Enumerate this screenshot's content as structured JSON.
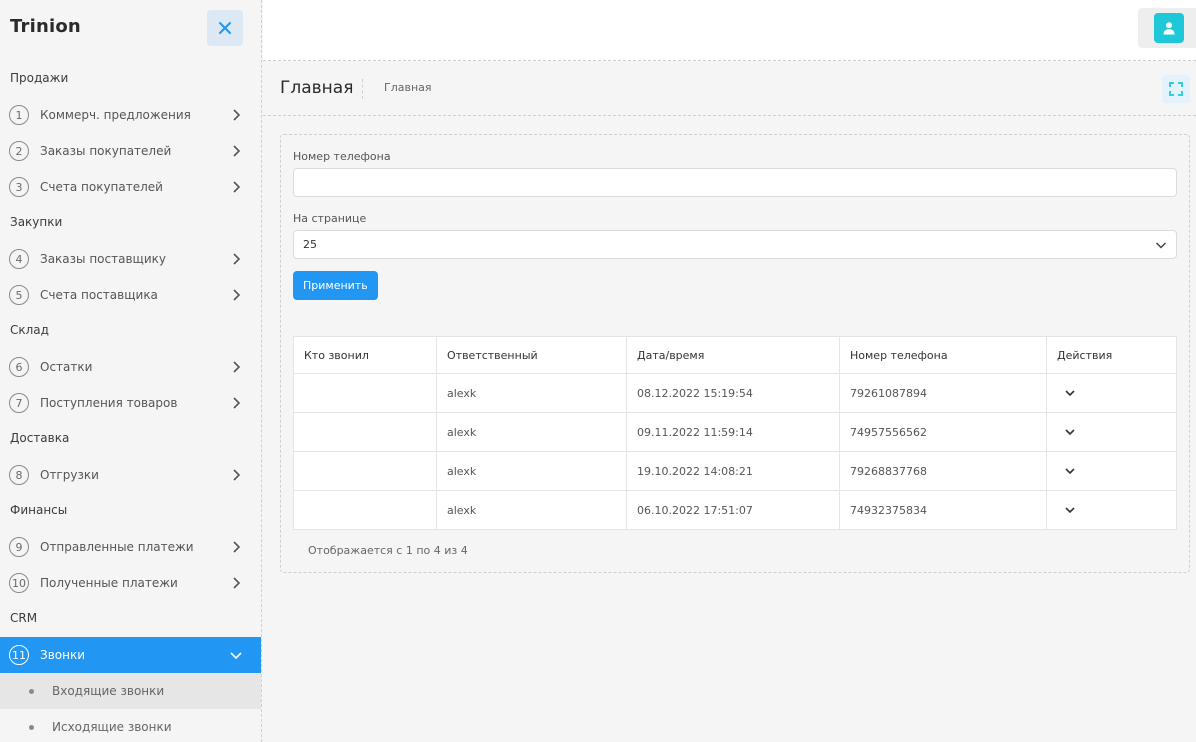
{
  "brand": "Trinion",
  "sidebar": {
    "sections": [
      "Продажи",
      "Закупки",
      "Склад",
      "Доставка",
      "Финансы",
      "CRM"
    ],
    "items": [
      {
        "num": "1",
        "label": "Коммерч. предложения"
      },
      {
        "num": "2",
        "label": "Заказы покупателей"
      },
      {
        "num": "3",
        "label": "Счета покупателей"
      },
      {
        "num": "4",
        "label": "Заказы поставщику"
      },
      {
        "num": "5",
        "label": "Счета поставщика"
      },
      {
        "num": "6",
        "label": "Остатки"
      },
      {
        "num": "7",
        "label": "Поступления товаров"
      },
      {
        "num": "8",
        "label": "Отгрузки"
      },
      {
        "num": "9",
        "label": "Отправленные платежи"
      },
      {
        "num": "10",
        "label": "Полученные платежи"
      },
      {
        "num": "11",
        "label": "Звонки"
      }
    ],
    "subitems": [
      "Входящие звонки",
      "Исходящие звонки"
    ]
  },
  "page": {
    "title": "Главная",
    "breadcrumb": "Главная"
  },
  "filter": {
    "phone_label": "Номер телефона",
    "phone_value": "",
    "per_page_label": "На странице",
    "per_page_value": "25",
    "apply_label": "Применить"
  },
  "table": {
    "headers": [
      "Кто звонил",
      "Ответственный",
      "Дата/время",
      "Номер телефона",
      "Действия"
    ],
    "rows": [
      {
        "caller": "",
        "responsible": "alexk",
        "datetime": "08.12.2022 15:19:54",
        "phone": "79261087894"
      },
      {
        "caller": "",
        "responsible": "alexk",
        "datetime": "09.11.2022 11:59:14",
        "phone": "74957556562"
      },
      {
        "caller": "",
        "responsible": "alexk",
        "datetime": "19.10.2022 14:08:21",
        "phone": "79268837768"
      },
      {
        "caller": "",
        "responsible": "alexk",
        "datetime": "06.10.2022 17:51:07",
        "phone": "74932375834"
      }
    ],
    "summary": "Отображается с 1 по 4 из 4"
  },
  "colors": {
    "accent": "#2196f3",
    "user_icon": "#1ec8d8"
  },
  "icons": {
    "close": "close-icon",
    "user": "user-icon",
    "fullscreen": "fullscreen-icon",
    "chevron": "chevron-right-icon",
    "actions": "chevron-down-icon"
  }
}
